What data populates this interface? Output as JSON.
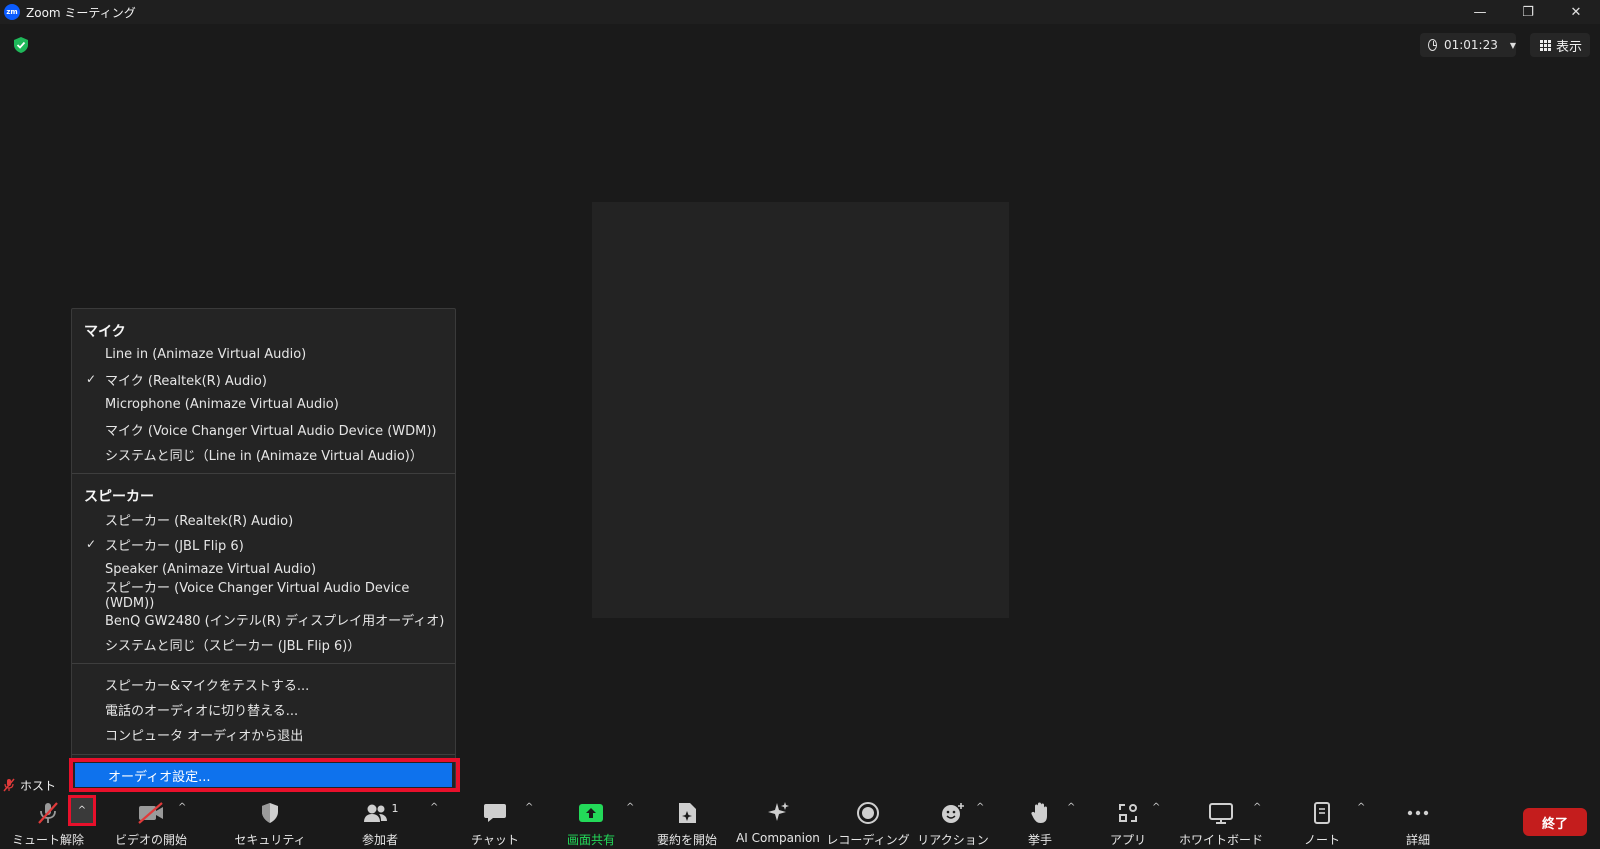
{
  "window": {
    "logo_text": "zm",
    "title": "Zoom ミーティング",
    "minimize_icon": "—",
    "restore_icon": "❐",
    "close_icon": "✕"
  },
  "top_controls": {
    "timer": "01:01:23",
    "view_label": "表示"
  },
  "audio_menu": {
    "mic_header": "マイク",
    "mic_items": [
      "Line in (Animaze Virtual Audio)",
      "マイク (Realtek(R) Audio)",
      "Microphone (Animaze Virtual Audio)",
      "マイク (Voice Changer Virtual Audio Device (WDM))",
      "システムと同じ（Line in (Animaze Virtual Audio)）"
    ],
    "mic_selected_index": 1,
    "speaker_header": "スピーカー",
    "speaker_items": [
      "スピーカー (Realtek(R) Audio)",
      "スピーカー (JBL Flip 6)",
      "Speaker (Animaze Virtual Audio)",
      "スピーカー (Voice Changer Virtual Audio Device (WDM))",
      "BenQ GW2480 (インテル(R) ディスプレイ用オーディオ)",
      "システムと同じ（スピーカー (JBL Flip 6)）"
    ],
    "speaker_selected_index": 1,
    "actions": [
      "スピーカー&マイクをテストする...",
      "電話のオーディオに切り替える...",
      "コンピュータ オーディオから退出"
    ],
    "audio_settings": "オーディオ設定...",
    "check_mark": "✓"
  },
  "host_label": "ホスト",
  "toolbar": {
    "unmute": "ミュート解除",
    "start_video": "ビデオの開始",
    "security": "セキュリティ",
    "participants": "参加者",
    "participants_count": "1",
    "chat": "チャット",
    "share_screen": "画面共有",
    "summary": "要約を開始",
    "ai_companion": "AI Companion",
    "recording": "レコーディング",
    "reactions": "リアクション",
    "raise_hand": "挙手",
    "apps": "アプリ",
    "whiteboard": "ホワイトボード",
    "notes": "ノート",
    "more": "詳細",
    "end": "終了",
    "caret": "^"
  },
  "colors": {
    "accent_blue": "#0e72ed",
    "share_green": "#23d959",
    "end_red": "#c41d1d",
    "highlight_red_outline": "#e8102b"
  }
}
